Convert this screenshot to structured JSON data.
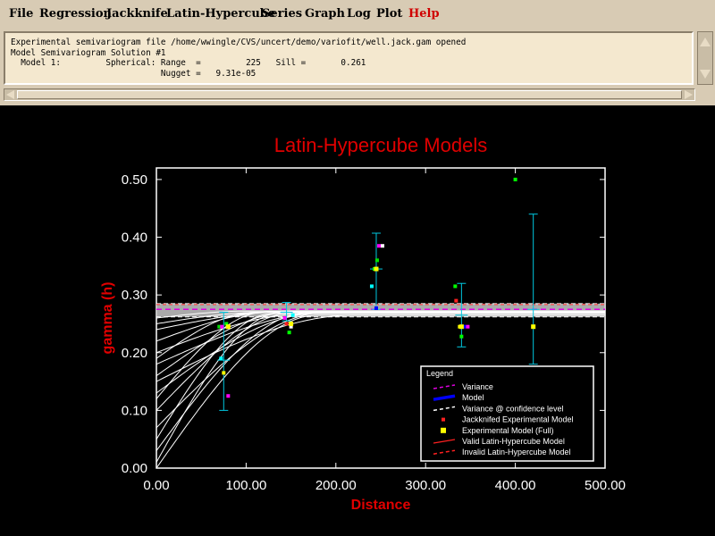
{
  "menu": {
    "items": [
      {
        "label": "File",
        "name": "menu-file",
        "color": "#000000"
      },
      {
        "label": "Regression",
        "name": "menu-regression",
        "color": "#000000"
      },
      {
        "label": "Jackknife",
        "name": "menu-jackknife",
        "color": "#000000"
      },
      {
        "label": "Latin-Hypercube",
        "name": "menu-latin-hypercube",
        "color": "#000000"
      },
      {
        "label": "Series",
        "name": "menu-series",
        "color": "#000000"
      },
      {
        "label": "Graph",
        "name": "menu-graph",
        "color": "#000000"
      },
      {
        "label": "Log",
        "name": "menu-log",
        "color": "#000000"
      },
      {
        "label": "Plot",
        "name": "menu-plot",
        "color": "#000000"
      },
      {
        "label": "Help",
        "name": "menu-help",
        "color": "#d00000"
      }
    ]
  },
  "log": {
    "lines": [
      "Experimental semivariogram file /home/wwingle/CVS/uncert/demo/variofit/well.jack.gam opened",
      "Model Semivariogram Solution #1",
      "  Model 1:         Spherical: Range  =         225   Sill =       0.261",
      "                              Nugget =   9.31e-05"
    ]
  },
  "chart_data": {
    "type": "scatter",
    "title": "Latin-Hypercube Models",
    "xlabel": "Distance",
    "ylabel": "gamma (h)",
    "xlim": [
      0,
      500
    ],
    "ylim": [
      0,
      0.52
    ],
    "x_ticks": [
      "0.00",
      "100.00",
      "200.00",
      "300.00",
      "400.00",
      "500.00"
    ],
    "y_ticks": [
      "0.00",
      "0.10",
      "0.20",
      "0.30",
      "0.40",
      "0.50"
    ],
    "colors": {
      "title": "#e00000",
      "axis_label": "#e00000",
      "tick_label": "#ffffff",
      "axes": "#ffffff",
      "error_bar": "#00c8e0",
      "model_band": "#c8c8c8",
      "model_lines": "#ffffff",
      "variance": "#e000e0",
      "model": "#0000ff",
      "invalid_model": "#ff2020"
    },
    "variance_level": 0.275,
    "confidence_levels": [
      0.262,
      0.285
    ],
    "model_params": {
      "range": 225,
      "sill": 0.261,
      "nugget": 9.31e-05
    },
    "experimental_full": [
      {
        "x": 80,
        "y": 0.245
      },
      {
        "x": 150,
        "y": 0.25
      },
      {
        "x": 245,
        "y": 0.345
      },
      {
        "x": 340,
        "y": 0.245
      },
      {
        "x": 420,
        "y": 0.245
      }
    ],
    "error_bars": [
      {
        "x": 75,
        "low": 0.1,
        "high": 0.27,
        "center": 0.187
      },
      {
        "x": 145,
        "low": 0.255,
        "high": 0.287,
        "center": 0.27
      },
      {
        "x": 245,
        "low": 0.275,
        "high": 0.407,
        "center": 0.345
      },
      {
        "x": 340,
        "low": 0.21,
        "high": 0.32,
        "center": 0.265
      },
      {
        "x": 420,
        "low": 0.18,
        "high": 0.44,
        "center": 0.275
      }
    ],
    "jackknifed_points": [
      {
        "x": 70,
        "y": 0.245,
        "color": "#00e000"
      },
      {
        "x": 73,
        "y": 0.245,
        "color": "#ff00ff"
      },
      {
        "x": 75,
        "y": 0.165,
        "color": "#ffff00"
      },
      {
        "x": 78,
        "y": 0.25,
        "color": "#00ff00"
      },
      {
        "x": 80,
        "y": 0.125,
        "color": "#ff00ff"
      },
      {
        "x": 72,
        "y": 0.19,
        "color": "#00ffff"
      },
      {
        "x": 145,
        "y": 0.25,
        "color": "#ff2020"
      },
      {
        "x": 148,
        "y": 0.235,
        "color": "#00ff00"
      },
      {
        "x": 150,
        "y": 0.245,
        "color": "#ffffff"
      },
      {
        "x": 152,
        "y": 0.265,
        "color": "#00ffff"
      },
      {
        "x": 143,
        "y": 0.26,
        "color": "#ff00ff"
      },
      {
        "x": 240,
        "y": 0.315,
        "color": "#00ffff"
      },
      {
        "x": 243,
        "y": 0.345,
        "color": "#00ff00"
      },
      {
        "x": 246,
        "y": 0.36,
        "color": "#00e000"
      },
      {
        "x": 248,
        "y": 0.385,
        "color": "#ff00ff"
      },
      {
        "x": 252,
        "y": 0.385,
        "color": "#ffffff"
      },
      {
        "x": 245,
        "y": 0.277,
        "color": "#0000ff"
      },
      {
        "x": 333,
        "y": 0.315,
        "color": "#00ff00"
      },
      {
        "x": 334,
        "y": 0.29,
        "color": "#ff2020"
      },
      {
        "x": 338,
        "y": 0.245,
        "color": "#ffff00"
      },
      {
        "x": 340,
        "y": 0.228,
        "color": "#00ff00"
      },
      {
        "x": 343,
        "y": 0.245,
        "color": "#0000ff"
      },
      {
        "x": 347,
        "y": 0.245,
        "color": "#ff00ff"
      },
      {
        "x": 400,
        "y": 0.5,
        "color": "#00ff00"
      }
    ],
    "hypercube_models": [
      {
        "nugget": 0.01,
        "sill": 0.27,
        "range": 140
      },
      {
        "nugget": 0.03,
        "sill": 0.27,
        "range": 170
      },
      {
        "nugget": 0.05,
        "sill": 0.268,
        "range": 130
      },
      {
        "nugget": 0.07,
        "sill": 0.27,
        "range": 190
      },
      {
        "nugget": 0.1,
        "sill": 0.272,
        "range": 160
      },
      {
        "nugget": 0.12,
        "sill": 0.27,
        "range": 120
      },
      {
        "nugget": 0.13,
        "sill": 0.268,
        "range": 180
      },
      {
        "nugget": 0.16,
        "sill": 0.27,
        "range": 150
      },
      {
        "nugget": 0.18,
        "sill": 0.272,
        "range": 200
      },
      {
        "nugget": 0.19,
        "sill": 0.27,
        "range": 110
      },
      {
        "nugget": 0.2,
        "sill": 0.268,
        "range": 170
      },
      {
        "nugget": 0.22,
        "sill": 0.27,
        "range": 130
      },
      {
        "nugget": 0.24,
        "sill": 0.272,
        "range": 150
      },
      {
        "nugget": 0.25,
        "sill": 0.27,
        "range": 120
      },
      {
        "nugget": 0.26,
        "sill": 0.272,
        "range": 100
      },
      {
        "nugget": 0.0,
        "sill": 0.265,
        "range": 180
      },
      {
        "nugget": 0.15,
        "sill": 0.265,
        "range": 220
      }
    ],
    "legend": {
      "title": "Legend",
      "position": "bottom-right",
      "entries": [
        {
          "label": "Variance",
          "symbol": "dash",
          "color": "#e000e0"
        },
        {
          "label": "Model",
          "symbol": "thick",
          "color": "#0000ff"
        },
        {
          "label": "Variance @ confidence level",
          "symbol": "dash",
          "color": "#ffffff"
        },
        {
          "label": "Jackknifed Experimental Model",
          "symbol": "dot",
          "color": "#ff2020"
        },
        {
          "label": "Experimental Model (Full)",
          "symbol": "square",
          "color": "#ffff00"
        },
        {
          "label": "Valid Latin-Hypercube Model",
          "symbol": "line",
          "color": "#ff2020"
        },
        {
          "label": "Invalid Latin-Hypercube Model",
          "symbol": "dash",
          "color": "#ff2020"
        }
      ]
    }
  }
}
